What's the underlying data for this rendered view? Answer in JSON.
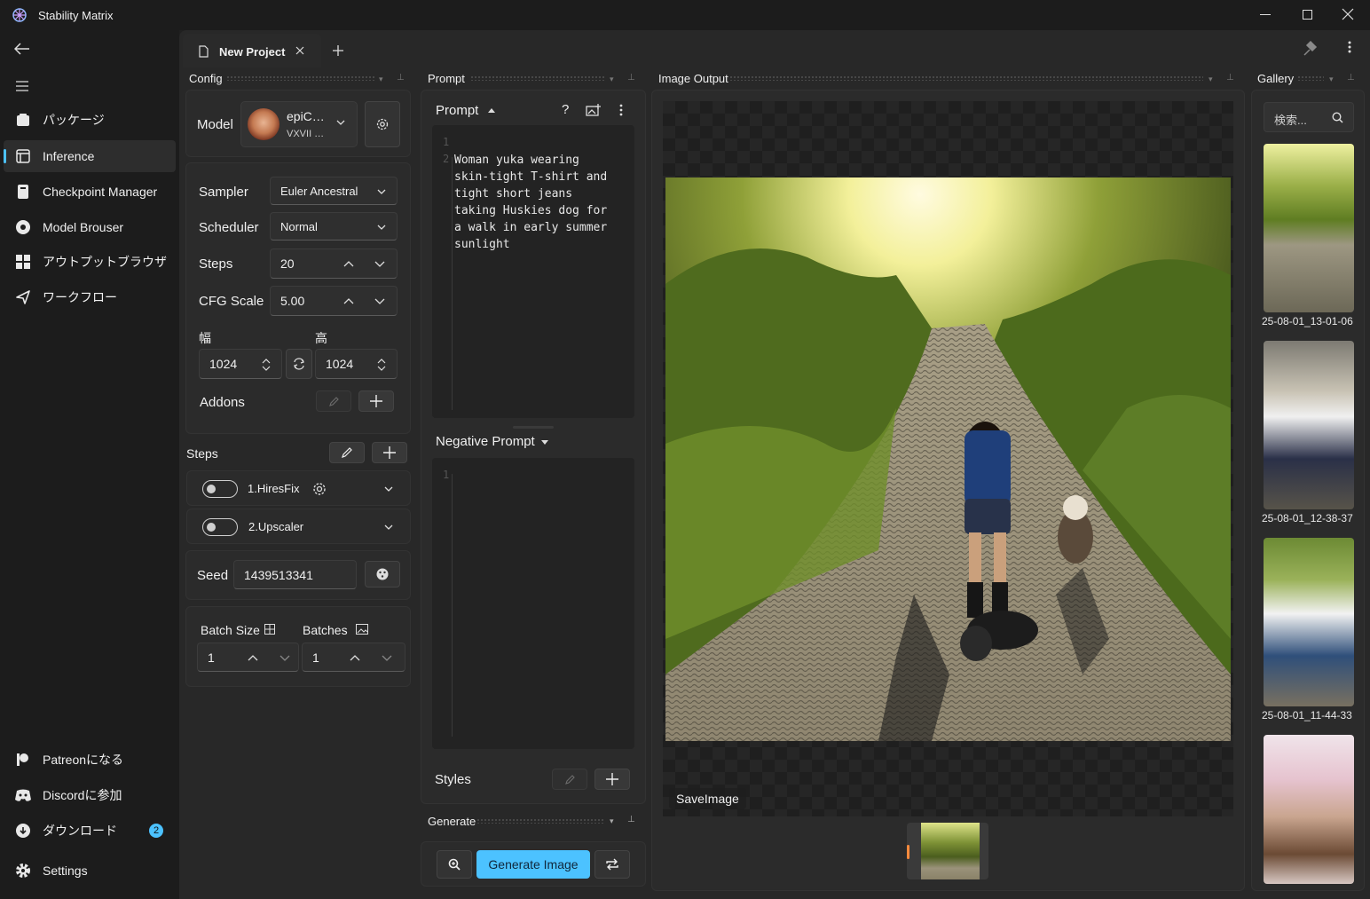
{
  "window": {
    "title": "Stability Matrix"
  },
  "sidebar": {
    "items": [
      {
        "label": "パッケージ"
      },
      {
        "label": "Inference"
      },
      {
        "label": "Checkpoint Manager"
      },
      {
        "label": "Model Brouser"
      },
      {
        "label": "アウトプットブラウザ"
      },
      {
        "label": "ワークフロー"
      }
    ],
    "footer": [
      {
        "label": "Patreonになる"
      },
      {
        "label": "Discordに参加"
      },
      {
        "label": "ダウンロード",
        "badge": "2"
      },
      {
        "label": "Settings"
      }
    ]
  },
  "tabs": [
    {
      "label": "New Project"
    }
  ],
  "config": {
    "title": "Config",
    "model_label": "Model",
    "model_name": "epiC…",
    "model_version": "VXVII …",
    "sampler_label": "Sampler",
    "sampler_value": "Euler Ancestral",
    "scheduler_label": "Scheduler",
    "scheduler_value": "Normal",
    "steps_label": "Steps",
    "steps_value": "20",
    "cfg_label": "CFG Scale",
    "cfg_value": "5.00",
    "width_label": "幅",
    "width_value": "1024",
    "height_label": "高",
    "height_value": "1024",
    "addons_label": "Addons",
    "steps_section_label": "Steps",
    "step_items": [
      {
        "label": "1.HiresFix"
      },
      {
        "label": "2.Upscaler"
      }
    ],
    "seed_label": "Seed",
    "seed_value": "1439513341",
    "batch_size_label": "Batch Size",
    "batch_size_value": "1",
    "batches_label": "Batches",
    "batches_value": "1"
  },
  "prompt": {
    "title": "Prompt",
    "header": "Prompt",
    "line_numbers": [
      "1",
      "2"
    ],
    "text": "Woman yuka wearing\nskin-tight T-shirt and\ntight short jeans\ntaking Huskies dog for\na walk in early summer\nsunlight",
    "negative_header": "Negative Prompt",
    "negative_line_numbers": [
      "1"
    ],
    "styles_label": "Styles"
  },
  "generate": {
    "title": "Generate",
    "button_label": "Generate Image"
  },
  "image_output": {
    "title": "Image Output",
    "save_label": "SaveImage"
  },
  "gallery": {
    "title": "Gallery",
    "search_placeholder": "検索...",
    "items": [
      {
        "caption": "25-08-01_13-01-06"
      },
      {
        "caption": "25-08-01_12-38-37"
      },
      {
        "caption": "25-08-01_11-44-33"
      },
      {
        "caption": ""
      }
    ]
  },
  "colors": {
    "accent": "#4cc2ff",
    "badge": "#4cc2ff",
    "background": "#202020"
  }
}
